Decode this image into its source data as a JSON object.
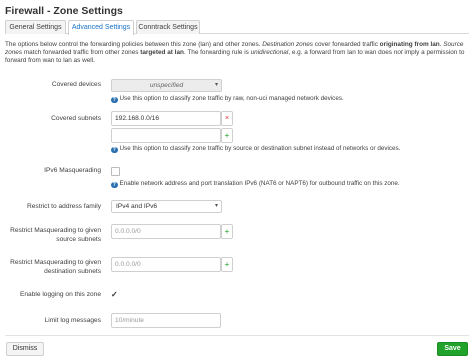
{
  "title": "Firewall - Zone Settings",
  "tabs": [
    {
      "label": "General Settings"
    },
    {
      "label": "Advanced Settings"
    },
    {
      "label": "Conntrack Settings"
    }
  ],
  "description": {
    "p1": "The options below control the forwarding policies between this zone (lan) and other zones. ",
    "p2": "Destination zones",
    "p3": " cover forwarded traffic ",
    "p4": "originating from lan",
    "p5": ". ",
    "p6": "Source zones",
    "p7": " match forwarded traffic from other zones ",
    "p8": "targeted at lan",
    "p9": ". The forwarding rule is ",
    "p10": "unidirectional",
    "p11": ", e.g. a forward from lan to wan does ",
    "p12": "not",
    "p13": " imply a permission to forward from wan to lan as well."
  },
  "fields": {
    "covered_devices": {
      "label": "Covered devices",
      "value": "unspecified",
      "help": "Use this option to classify zone traffic by raw, non-uci managed network devices."
    },
    "covered_subnets": {
      "label": "Covered subnets",
      "value": "192.168.0.0/16",
      "help": "Use this option to classify zone traffic by source or destination subnet instead of networks or devices."
    },
    "ipv6_masq": {
      "label": "IPv6 Masquerading",
      "help": "Enable network address and port translation IPv6 (NAT6 or NAPT6) for outbound traffic on this zone."
    },
    "restrict_family": {
      "label": "Restrict to address family",
      "value": "IPv4 and IPv6"
    },
    "masq_src": {
      "label_line1": "Restrict Masquerading to given",
      "label_line2": "source subnets",
      "placeholder": "0.0.0.0/0"
    },
    "masq_dest": {
      "label_line1": "Restrict Masquerading to given",
      "label_line2": "destination subnets",
      "placeholder": "0.0.0.0/0"
    },
    "logging": {
      "label": "Enable logging on this zone",
      "checked": true
    },
    "limit_log": {
      "label": "Limit log messages",
      "placeholder": "10/minute"
    }
  },
  "icons": {
    "help": "question-circle-icon",
    "add": "plus-icon",
    "remove": "x-icon",
    "dropdown": "chevron-down-icon",
    "check": "checkmark-icon"
  },
  "buttons": {
    "dismiss": "Dismiss",
    "save": "Save"
  },
  "colors": {
    "tab_active_text": "#1a73c9",
    "save_bg": "#21a32b",
    "help_icon": "#2a6fb0",
    "add_icon": "#2a9d2a",
    "remove_icon": "#d03030"
  }
}
